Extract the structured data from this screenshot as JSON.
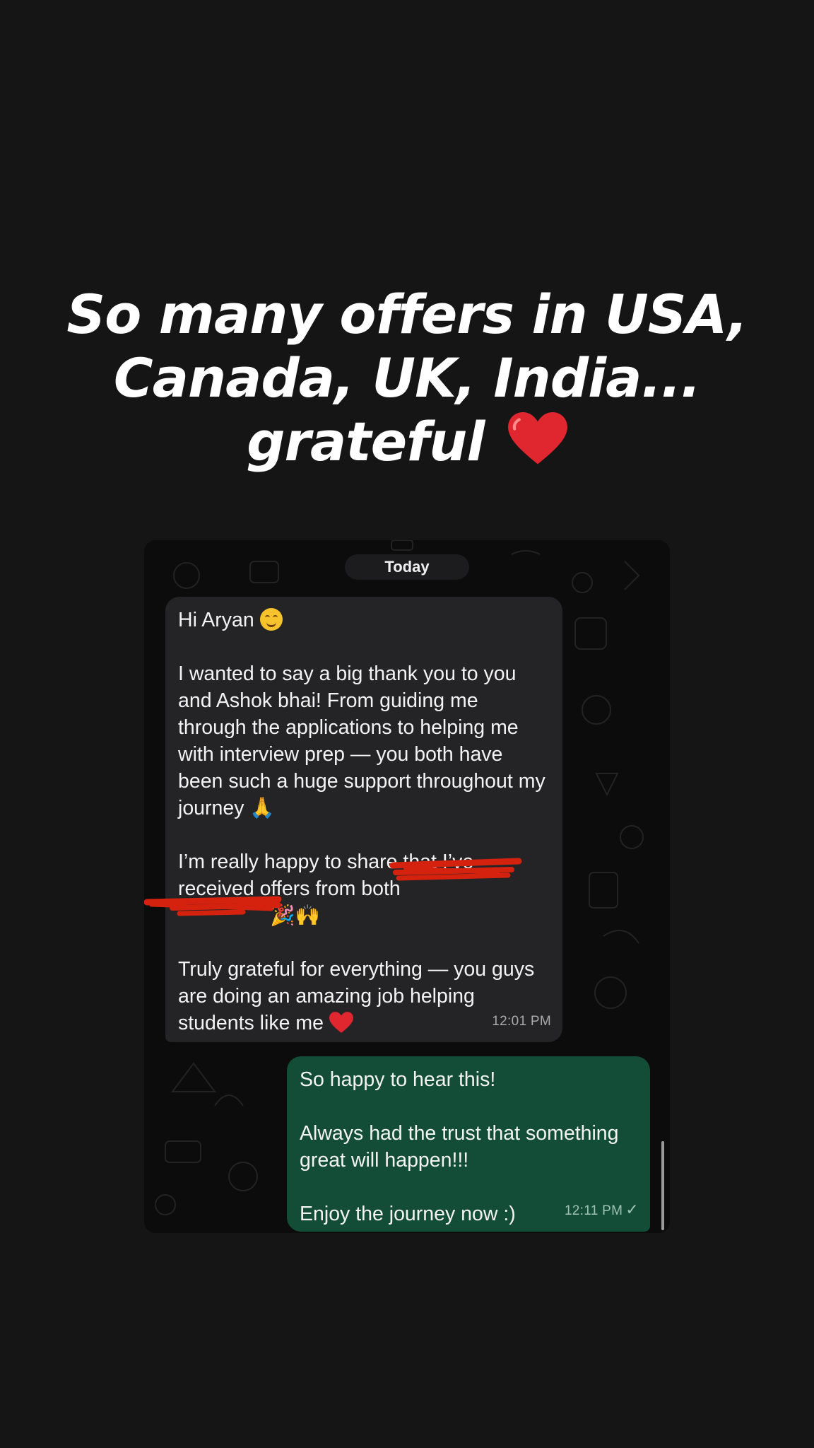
{
  "headline": {
    "lines": [
      "So many offers in USA,",
      "Canada, UK, India...",
      "grateful"
    ],
    "emoji": "red-heart-icon"
  },
  "chat": {
    "date_chip": "Today",
    "incoming": {
      "greeting": "Hi Aryan",
      "greeting_emoji": "smiling-face-icon",
      "para1": "I wanted to say a big thank you to you and Ashok bhai! From guiding me through the applications to helping me with interview prep — you both have been such a huge support throughout my journey",
      "para1_emoji": "🙏",
      "para2": "I’m really happy to share that I’ve received offers from both",
      "para2_emoji": "🎉🙌",
      "para3": "Truly grateful for everything — you guys are doing an amazing job helping students like me",
      "para3_emoji": "red-heart-icon",
      "time": "12:01 PM"
    },
    "outgoing": {
      "line1": "So happy to hear this!",
      "line2": "Always had the trust that something great will happen!!!",
      "line3": "Enjoy the journey now :)",
      "time": "12:11 PM",
      "status": "✓"
    }
  },
  "colors": {
    "background": "#151515",
    "incoming_bubble": "#242426",
    "outgoing_bubble": "#144d37",
    "redaction": "#d4220f"
  }
}
